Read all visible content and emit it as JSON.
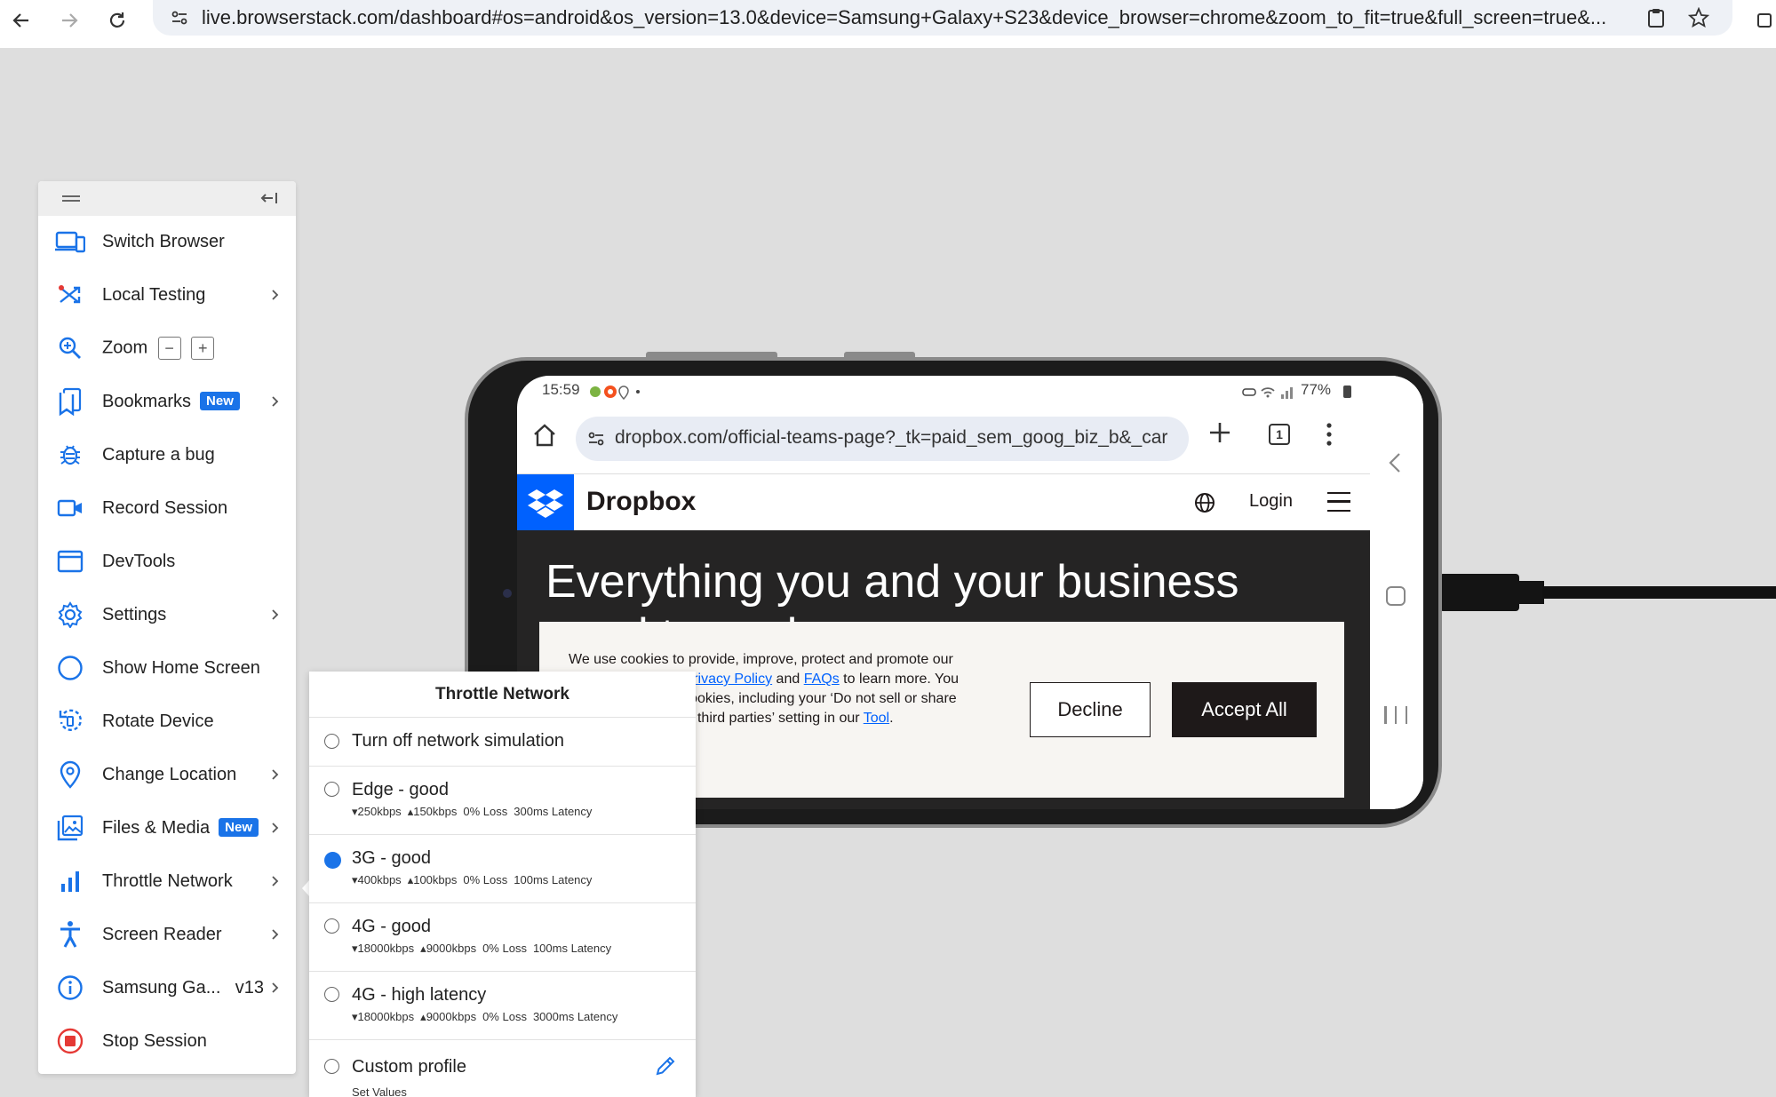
{
  "browser": {
    "url": "live.browserstack.com/dashboard#os=android&os_version=13.0&device=Samsung+Galaxy+S23&device_browser=chrome&zoom_to_fit=true&full_screen=true&..."
  },
  "toolbar": {
    "items": [
      {
        "label": "Switch Browser",
        "icon": "switch-browser-icon"
      },
      {
        "label": "Local Testing",
        "icon": "local-testing-icon"
      },
      {
        "label": "Zoom",
        "icon": "zoom-icon",
        "zoom_out": "−",
        "zoom_in": "+"
      },
      {
        "label": "Bookmarks",
        "icon": "bookmark-icon",
        "badge": "New"
      },
      {
        "label": "Capture a bug",
        "icon": "bug-icon"
      },
      {
        "label": "Record Session",
        "icon": "video-camera-icon"
      },
      {
        "label": "DevTools",
        "icon": "devtools-window-icon"
      },
      {
        "label": "Settings",
        "icon": "gear-icon"
      },
      {
        "label": "Show Home Screen",
        "icon": "home-circle-icon"
      },
      {
        "label": "Rotate Device",
        "icon": "rotate-icon"
      },
      {
        "label": "Change Location",
        "icon": "location-pin-icon"
      },
      {
        "label": "Files & Media",
        "icon": "image-gallery-icon",
        "badge": "New"
      },
      {
        "label": "Throttle Network",
        "icon": "signal-bars-icon"
      },
      {
        "label": "Screen Reader",
        "icon": "accessibility-icon"
      },
      {
        "label": "Samsung Ga...",
        "icon": "info-icon",
        "version": "v13"
      },
      {
        "label": "Stop Session",
        "icon": "stop-icon"
      }
    ]
  },
  "throttle": {
    "title": "Throttle Network",
    "options": [
      {
        "label": "Turn off network simulation",
        "selected": false
      },
      {
        "label": "Edge - good",
        "down": "250kbps",
        "up": "150kbps",
        "loss": "0% Loss",
        "latency": "300ms Latency",
        "selected": false
      },
      {
        "label": "3G - good",
        "down": "400kbps",
        "up": "100kbps",
        "loss": "0% Loss",
        "latency": "100ms Latency",
        "selected": true
      },
      {
        "label": "4G - good",
        "down": "18000kbps",
        "up": "9000kbps",
        "loss": "0% Loss",
        "latency": "100ms Latency",
        "selected": false
      },
      {
        "label": "4G - high latency",
        "down": "18000kbps",
        "up": "9000kbps",
        "loss": "0% Loss",
        "latency": "3000ms Latency",
        "selected": false
      },
      {
        "label": "Custom profile",
        "sub": "Set Values",
        "selected": false
      }
    ]
  },
  "device": {
    "status_time": "15:59",
    "battery": "77%",
    "url": "dropbox.com/official-teams-page?_tk=paid_sem_goog_biz_b&_car",
    "tab_count": "1",
    "site": {
      "brand": "Dropbox",
      "login": "Login",
      "hero": "Everything you and your business need to work",
      "cookie_pre": "We use cookies to provide, improve, protect and promote our services. Visit our ",
      "privacy_link": "Privacy Policy",
      "cookie_mid": " and ",
      "faq_link": "FAQs",
      "cookie_post": " to learn more. You can manage your cookies, including your ‘Do not sell or share my personal data to third parties’ setting in our ",
      "tool_link": "Tool",
      "cookie_end": ".",
      "decline": "Decline",
      "accept": "Accept All"
    }
  },
  "colors": {
    "accent": "#1a73e8",
    "dropbox_blue": "#0061fe",
    "stop_red": "#e53935"
  }
}
